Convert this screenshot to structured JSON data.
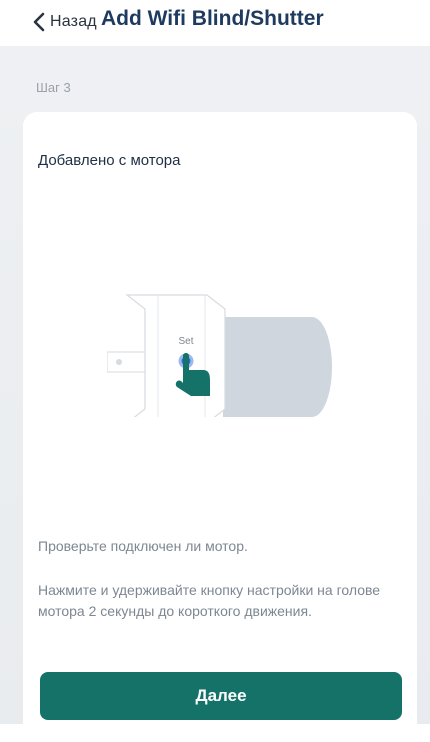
{
  "header": {
    "back_label": "Назад",
    "title": "Add Wifi Blind/Shutter"
  },
  "step": {
    "label": "Шаг 3"
  },
  "card": {
    "title": "Добавлено с мотора",
    "illustration": {
      "set_label": "Set",
      "icons": [
        "motor-head",
        "set-button",
        "hand-pointer"
      ]
    },
    "check_text": "Проверьте подключен ли мотор.",
    "instruction_text": "Нажмите и удерживайте кнопку настройки на голове мотора 2 секунды до короткого движения."
  },
  "actions": {
    "next_label": "Далее"
  },
  "colors": {
    "primary": "#157269",
    "title": "#1e3a5f",
    "background": "#eceef1",
    "motor_body": "#cfd6dd"
  }
}
